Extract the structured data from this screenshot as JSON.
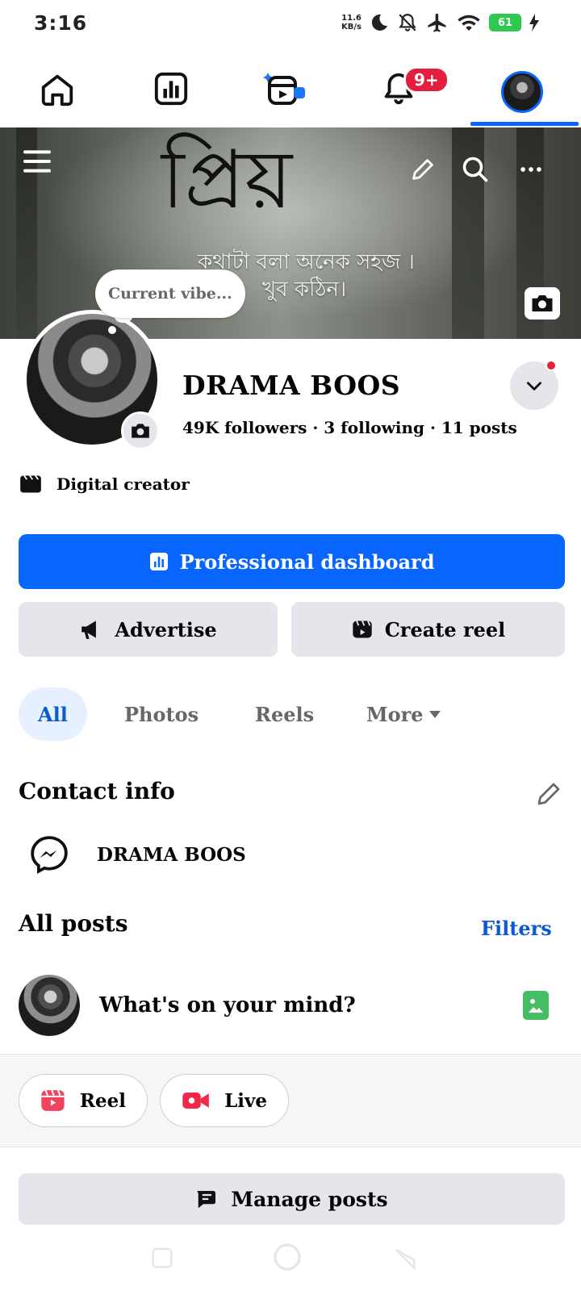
{
  "status_bar": {
    "time": "3:16",
    "net_speed_value": "11.6",
    "net_speed_unit": "KB/s",
    "battery": "61"
  },
  "top_nav": {
    "items": [
      "home-icon",
      "dashboard-icon",
      "reels-icon",
      "notifications-icon",
      "profile-avatar"
    ],
    "notification_badge": "9+",
    "active_item": "profile-avatar"
  },
  "cover": {
    "title_art": "প্রিয়",
    "subtitle_line1": "কথাটা বলা অনেক সহজ ।",
    "subtitle_line2": "খুব কঠিন।"
  },
  "profile": {
    "vibe_prompt": "Current vibe...",
    "name": "DRAMA BOOS",
    "stats": "49K followers · 3 following · 11 posts",
    "category": "Digital creator"
  },
  "buttons": {
    "professional_dashboard": "Professional dashboard",
    "advertise": "Advertise",
    "create_reel": "Create reel",
    "manage_posts": "Manage posts"
  },
  "tabs": {
    "all": "All",
    "photos": "Photos",
    "reels": "Reels",
    "more": "More"
  },
  "contact_info": {
    "title": "Contact info",
    "messenger_name": "DRAMA BOOS"
  },
  "posts": {
    "title": "All posts",
    "filters": "Filters",
    "composer_placeholder": "What's on your mind?",
    "reel_label": "Reel",
    "live_label": "Live"
  },
  "colors": {
    "accent": "#0866ff",
    "link": "#0a5ad4",
    "badge": "#e41e3f",
    "secondary_bg": "#e4e6eb"
  }
}
